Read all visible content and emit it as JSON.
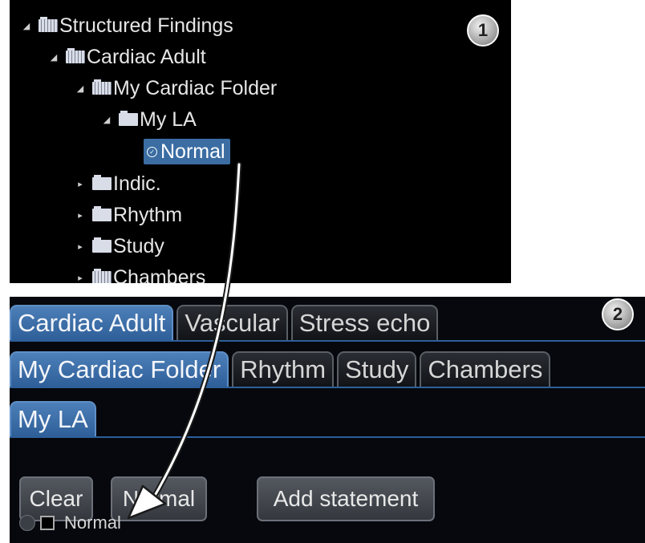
{
  "tree": {
    "items": [
      {
        "label": "Structured Findings",
        "expanded": true
      },
      {
        "label": "Cardiac Adult",
        "expanded": true
      },
      {
        "label": "My Cardiac Folder",
        "expanded": true
      },
      {
        "label": "My LA",
        "expanded": true
      },
      {
        "label": "Normal",
        "selected": true
      },
      {
        "label": "Indic.",
        "expanded": false
      },
      {
        "label": "Rhythm",
        "expanded": false
      },
      {
        "label": "Study",
        "expanded": false
      },
      {
        "label": "Chambers",
        "expanded": false
      }
    ],
    "step_badge": "1"
  },
  "tabs": {
    "step_badge": "2",
    "level1": [
      "Cardiac Adult",
      "Vascular",
      "Stress echo"
    ],
    "level2": [
      "My Cardiac Folder",
      "Rhythm",
      "Study",
      "Chambers"
    ],
    "level3": [
      "My LA"
    ]
  },
  "buttons": {
    "clear": "Clear",
    "normal": "Normal",
    "add_statement": "Add statement"
  },
  "status": {
    "label": "Normal"
  },
  "colors": {
    "selection": "#3b6da3",
    "active_tab": "#3d70ab",
    "panel_background": "#000000"
  },
  "icons": {
    "folder": "folder-icon",
    "expand": "triangle-expanded-icon",
    "collapse": "triangle-collapsed-icon",
    "check": "check-circle-icon",
    "arrow": "curved-arrow-icon"
  }
}
